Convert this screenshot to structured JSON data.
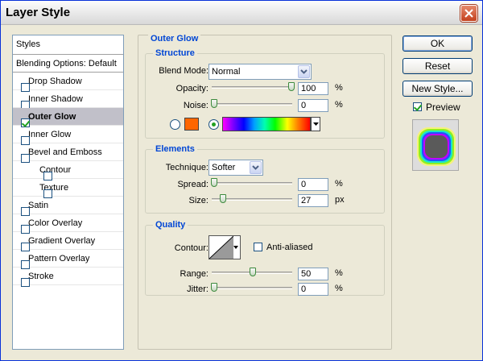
{
  "window": {
    "title": "Layer Style"
  },
  "styles_list": {
    "header": "Styles",
    "blending_options": "Blending Options: Default",
    "items": [
      {
        "label": "Drop Shadow",
        "checked": false,
        "indent": false,
        "selected": false
      },
      {
        "label": "Inner Shadow",
        "checked": false,
        "indent": false,
        "selected": false
      },
      {
        "label": "Outer Glow",
        "checked": true,
        "indent": false,
        "selected": true
      },
      {
        "label": "Inner Glow",
        "checked": false,
        "indent": false,
        "selected": false
      },
      {
        "label": "Bevel and Emboss",
        "checked": false,
        "indent": false,
        "selected": false
      },
      {
        "label": "Contour",
        "checked": false,
        "indent": true,
        "selected": false
      },
      {
        "label": "Texture",
        "checked": false,
        "indent": true,
        "selected": false
      },
      {
        "label": "Satin",
        "checked": false,
        "indent": false,
        "selected": false
      },
      {
        "label": "Color Overlay",
        "checked": false,
        "indent": false,
        "selected": false
      },
      {
        "label": "Gradient Overlay",
        "checked": false,
        "indent": false,
        "selected": false
      },
      {
        "label": "Pattern Overlay",
        "checked": false,
        "indent": false,
        "selected": false
      },
      {
        "label": "Stroke",
        "checked": false,
        "indent": false,
        "selected": false
      }
    ]
  },
  "outer_glow": {
    "title": "Outer Glow",
    "structure": {
      "title": "Structure",
      "blend_mode_label": "Blend Mode:",
      "blend_mode_value": "Normal",
      "opacity_label": "Opacity:",
      "opacity_value": "100",
      "opacity_level": 1.0,
      "noise_label": "Noise:",
      "noise_value": "0",
      "noise_level": 0.0,
      "percent": "%",
      "glow_color": "#ff6600"
    },
    "elements": {
      "title": "Elements",
      "technique_label": "Technique:",
      "technique_value": "Softer",
      "spread_label": "Spread:",
      "spread_value": "0",
      "spread_level": 0.0,
      "size_label": "Size:",
      "size_value": "27",
      "size_level": 0.11,
      "percent": "%",
      "px": "px"
    },
    "quality": {
      "title": "Quality",
      "contour_label": "Contour:",
      "anti_aliased_label": "Anti-aliased",
      "range_label": "Range:",
      "range_value": "50",
      "range_level": 0.5,
      "jitter_label": "Jitter:",
      "jitter_value": "0",
      "jitter_level": 0.0,
      "percent": "%"
    }
  },
  "buttons": {
    "ok": "OK",
    "reset": "Reset",
    "new_style": "New Style...",
    "preview_label": "Preview",
    "preview_checked": true
  }
}
